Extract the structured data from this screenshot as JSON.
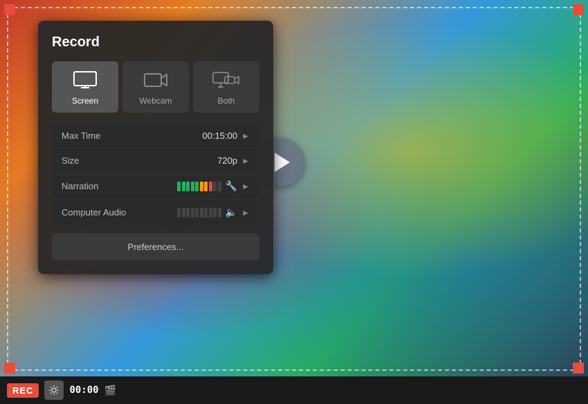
{
  "panel": {
    "title": "Record",
    "modes": [
      {
        "id": "screen",
        "label": "Screen",
        "active": true,
        "icon": "screen"
      },
      {
        "id": "webcam",
        "label": "Webcam",
        "active": false,
        "icon": "webcam"
      },
      {
        "id": "both",
        "label": "Both",
        "active": false,
        "icon": "both"
      }
    ],
    "settings": {
      "maxtime": {
        "label": "Max Time",
        "value": "00:15:00"
      },
      "size": {
        "label": "Size",
        "value": "720p"
      },
      "narration": {
        "label": "Narration"
      },
      "computeraudio": {
        "label": "Computer Audio"
      }
    },
    "preferences_label": "Preferences..."
  },
  "bottombar": {
    "rec_label": "REC",
    "timer": "00:00"
  }
}
